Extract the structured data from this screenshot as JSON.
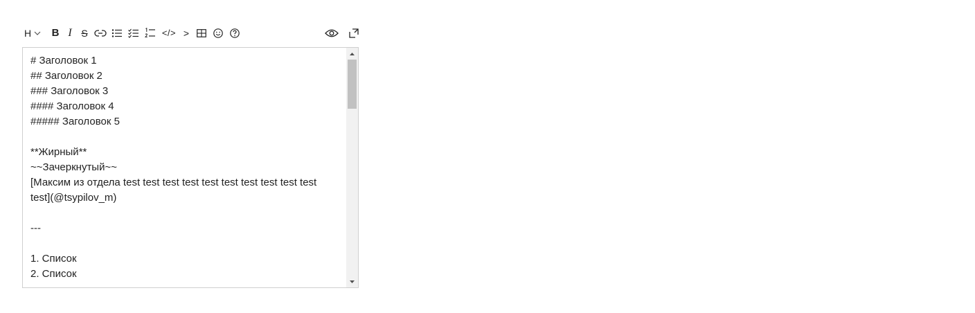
{
  "toolbar": {
    "heading_label": "H",
    "bold_label": "B",
    "italic_label": "I",
    "strike_label": "S",
    "code_label": "</>",
    "quote_label": ">",
    "icons": [
      "chevron-down-icon",
      "link-icon",
      "bullet-list-icon",
      "checklist-icon",
      "numbered-list-icon",
      "table-icon",
      "emoji-icon",
      "help-icon",
      "eye-icon",
      "expand-icon"
    ]
  },
  "editor": {
    "lines": [
      "# Заголовок 1",
      "## Заголовок 2",
      "### Заголовок 3",
      "#### Заголовок 4",
      "##### Заголовок 5",
      "",
      "**Жирный**",
      "~~Зачеркнутый~~",
      "[Максим из отдела test test test test test test test test test test test](@tsypilov_m)",
      "",
      "---",
      "",
      "1. Список",
      "2. Список"
    ]
  },
  "colors": {
    "text": "#222222",
    "border": "#cfcfcf",
    "scrollbar_track": "#f1f1f1",
    "scrollbar_thumb": "#c1c1c1"
  }
}
